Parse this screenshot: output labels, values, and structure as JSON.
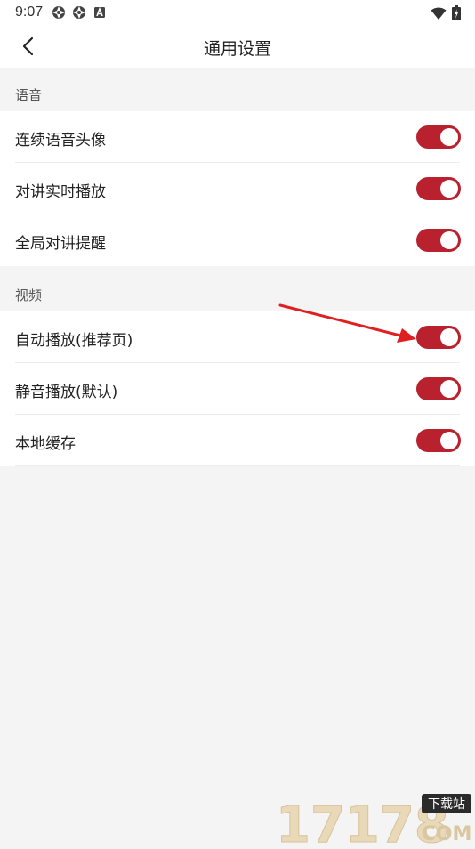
{
  "status_bar": {
    "time": "9:07",
    "icons": [
      "aperture-icon",
      "aperture-icon",
      "a-badge-icon"
    ],
    "right_icons": [
      "wifi-icon",
      "battery-charging-icon"
    ]
  },
  "header": {
    "title": "通用设置",
    "back_icon": "chevron-left-icon"
  },
  "sections": [
    {
      "label": "语音",
      "items": [
        {
          "label": "连续语音头像",
          "enabled": true
        },
        {
          "label": "对讲实时播放",
          "enabled": true
        },
        {
          "label": "全局对讲提醒",
          "enabled": true
        }
      ]
    },
    {
      "label": "视频",
      "items": [
        {
          "label": "自动播放(推荐页)",
          "enabled": true
        },
        {
          "label": "静音播放(默认)",
          "enabled": true
        },
        {
          "label": "本地缓存",
          "enabled": true
        }
      ]
    }
  ],
  "colors": {
    "accent": "#b9212f",
    "background": "#f4f4f4",
    "annotation_arrow": "#e02020"
  },
  "watermark": {
    "main": "17178",
    "badge": "下载站",
    "sub": "COM"
  }
}
